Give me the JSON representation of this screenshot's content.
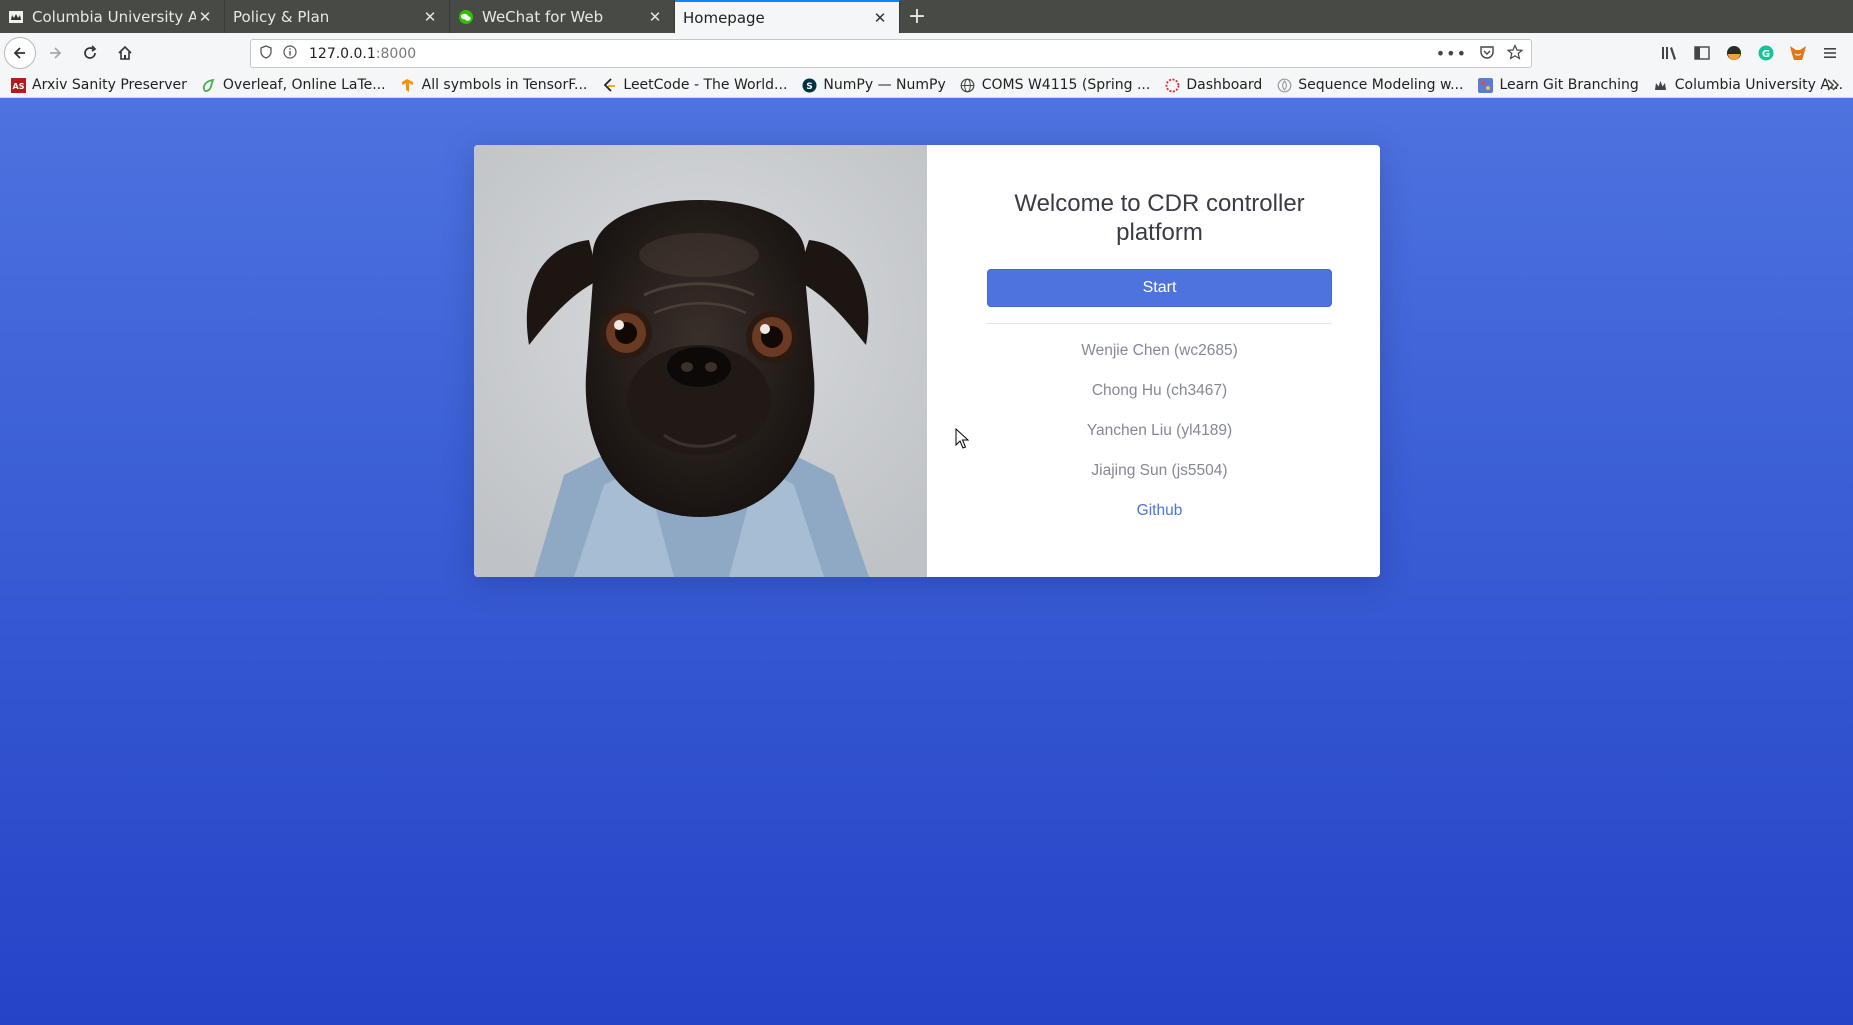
{
  "browser": {
    "tabs": [
      {
        "title": "Columbia University Auth",
        "favicon": "columbia-crown-icon"
      },
      {
        "title": "Policy & Plan",
        "favicon": ""
      },
      {
        "title": "WeChat for Web",
        "favicon": "wechat-icon"
      },
      {
        "title": "Homepage",
        "favicon": "",
        "active": true
      }
    ],
    "url": {
      "host": "127.0.0.1",
      "port": ":8000"
    },
    "bookmarks": [
      {
        "label": "Arxiv Sanity Preserver",
        "icon": "arxiv-icon"
      },
      {
        "label": "Overleaf, Online LaTe...",
        "icon": "overleaf-icon"
      },
      {
        "label": "All symbols in TensorF...",
        "icon": "tensorflow-icon"
      },
      {
        "label": "LeetCode - The World...",
        "icon": "leetcode-icon"
      },
      {
        "label": "NumPy — NumPy",
        "icon": "numpy-icon"
      },
      {
        "label": "COMS W4115 (Spring ...",
        "icon": "globe-icon"
      },
      {
        "label": "Dashboard",
        "icon": "dashboard-icon"
      },
      {
        "label": "Sequence Modeling w...",
        "icon": "sequence-icon"
      },
      {
        "label": "Learn Git Branching",
        "icon": "git-icon"
      },
      {
        "label": "Columbia University A...",
        "icon": "columbia-crown-icon"
      }
    ]
  },
  "page": {
    "title": "Welcome to CDR controller platform",
    "start_label": "Start",
    "members": [
      "Wenjie Chen (wc2685)",
      "Chong Hu (ch3467)",
      "Yanchen Liu (yl4189)",
      "Jiajing Sun (js5504)"
    ],
    "github_label": "Github"
  },
  "colors": {
    "primary": "#4e73df",
    "muted_text": "#858796",
    "heading": "#3a3b45"
  }
}
